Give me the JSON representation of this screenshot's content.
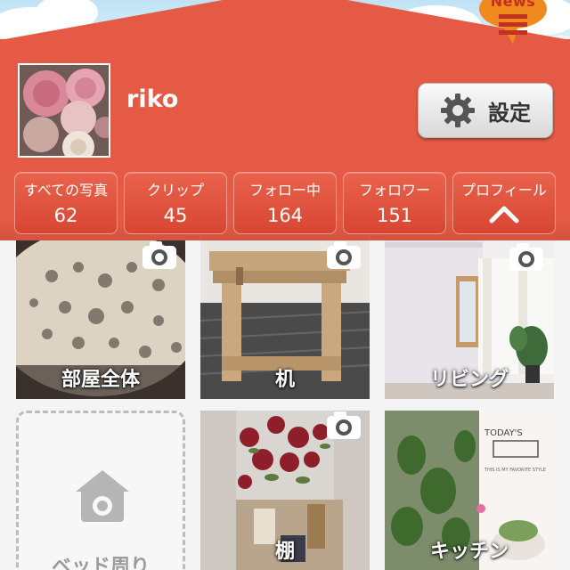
{
  "header": {
    "news_badge": "News",
    "username": "riko",
    "settings_label": "設定",
    "brand_color": "#e45a45"
  },
  "stats": [
    {
      "label": "すべての写真",
      "value": "62"
    },
    {
      "label": "クリップ",
      "value": "45"
    },
    {
      "label": "フォロー中",
      "value": "164"
    },
    {
      "label": "フォロワー",
      "value": "151"
    },
    {
      "label": "プロフィール",
      "icon": "chevron-up-icon"
    }
  ],
  "rooms": [
    {
      "label": "部屋全体",
      "has_camera": true
    },
    {
      "label": "机",
      "has_camera": true
    },
    {
      "label": "リビング",
      "has_camera": true
    },
    {
      "label": "ベッド周り",
      "empty": true,
      "icon": "house-camera-icon"
    },
    {
      "label": "棚",
      "has_camera": true
    },
    {
      "label": "キッチン",
      "has_camera": false
    }
  ],
  "photo_text": {
    "kitchen_note_1": "TODAY'S",
    "kitchen_note_2": "THIS IS MY FAVORITE STYLE"
  }
}
